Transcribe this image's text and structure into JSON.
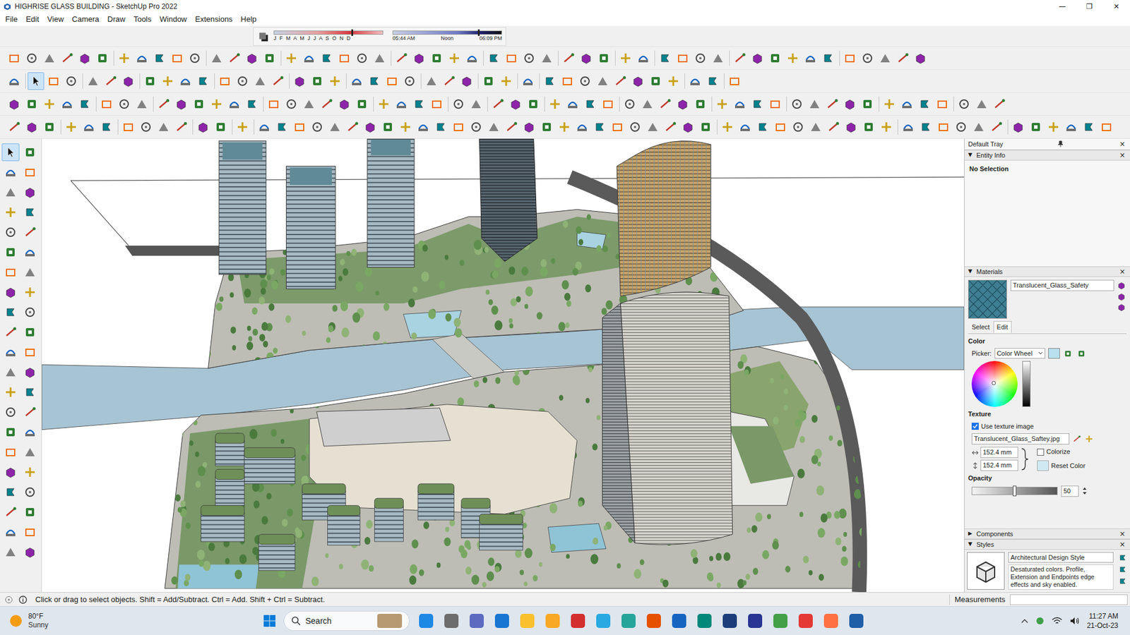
{
  "window": {
    "title": "HIGHRISE GLASS BUILDING - SketchUp Pro 2022",
    "controls": [
      "—",
      "❐",
      "✕"
    ]
  },
  "menu": [
    "File",
    "Edit",
    "View",
    "Camera",
    "Draw",
    "Tools",
    "Window",
    "Extensions",
    "Help"
  ],
  "shadows": {
    "months": "J F M A M J J A S O N D",
    "date_level": 0.71,
    "times": [
      "05:44 AM",
      "Noon",
      "06:09 PM"
    ],
    "time_level": 0.78
  },
  "tools": [
    {
      "name": "select",
      "selected": true
    }
  ],
  "tray": {
    "title": "Default Tray",
    "close": "×"
  },
  "entity_info": {
    "arrow": "▼",
    "title": "Entity Info",
    "expanded": true,
    "body": "No Selection"
  },
  "materials": {
    "arrow": "▼",
    "title": "Materials",
    "expanded": true,
    "name": "Translucent_Glass_Safety",
    "tabs": [
      {
        "label": "Select",
        "selected": false
      },
      {
        "label": "Edit",
        "selected": true
      }
    ],
    "color_heading": "Color",
    "picker_label": "Picker:",
    "picker_value": "Color Wheel",
    "texture_heading": "Texture",
    "use_texture": {
      "label": "Use texture image",
      "checked": true
    },
    "texture_file": "Translucent_Glass_Saftey.jpg",
    "size_width": "152.4 mm",
    "size_height": "152.4 mm",
    "colorize": {
      "label": "Colorize",
      "checked": false
    },
    "reset_color": "Reset Color",
    "opacity_heading": "Opacity",
    "opacity_value": "50",
    "opacity_level": 0.5
  },
  "components": {
    "arrow": "▶",
    "title": "Components",
    "expanded": false
  },
  "styles": {
    "arrow": "▼",
    "title": "Styles",
    "expanded": true,
    "name": "Architectural Design Style",
    "description": "Desaturated colors. Profile, Extension and Endpoints edge effects and sky enabled."
  },
  "status_bar": {
    "hint": "Click or drag to select objects. Shift = Add/Subtract. Ctrl = Add. Shift + Ctrl = Subtract.",
    "measurements": "Measurements"
  },
  "taskbar": {
    "temperature": "80°F",
    "weather": "Sunny",
    "search": "Search",
    "time": "11:27 AM",
    "date": "21-Oct-23"
  }
}
